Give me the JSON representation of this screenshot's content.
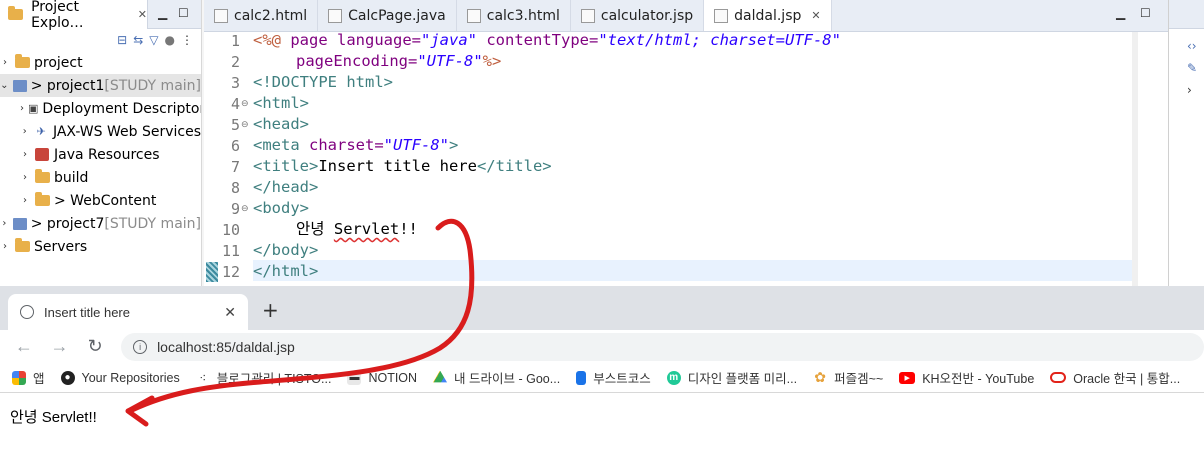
{
  "explorer": {
    "tab_title": "Project Explo…",
    "tree": [
      {
        "label": "project",
        "suffix": ""
      },
      {
        "label": "> project1",
        "suffix": " [STUDY main]"
      },
      {
        "label": "Deployment Descriptor",
        "suffix": ""
      },
      {
        "label": "JAX-WS Web Services",
        "suffix": ""
      },
      {
        "label": "Java Resources",
        "suffix": ""
      },
      {
        "label": "build",
        "suffix": ""
      },
      {
        "label": "> WebContent",
        "suffix": ""
      },
      {
        "label": "> project7",
        "suffix": " [STUDY main]"
      },
      {
        "label": "Servers",
        "suffix": ""
      }
    ]
  },
  "editor": {
    "tabs": [
      "calc2.html",
      "CalcPage.java",
      "calc3.html",
      "calculator.jsp",
      "daldal.jsp"
    ],
    "active_tab": "daldal.jsp",
    "line_numbers": [
      "1",
      "2",
      "3",
      "4",
      "5",
      "6",
      "7",
      "8",
      "9",
      "10",
      "11",
      "12"
    ],
    "code": {
      "l1_open": "<%@",
      "l1_page": " page",
      "l1_lang_attr": " language=",
      "l1_lang_val": "\"java\"",
      "l1_ct_attr": " contentType=",
      "l1_ct_val": "\"text/html; charset=UTF-8\"",
      "l2_attr": "pageEncoding=",
      "l2_val": "\"UTF-8\"",
      "l2_close": "%>",
      "l3": "<!DOCTYPE html>",
      "l4": "<html>",
      "l5": "<head>",
      "l6_tag": "<meta",
      "l6_attr": " charset=",
      "l6_val": "\"UTF-8\"",
      "l6_close": ">",
      "l7_open": "<title>",
      "l7_text": "Insert title here",
      "l7_close": "</title>",
      "l8": "</head>",
      "l9": "<body>",
      "l10_a": "안녕 ",
      "l10_b": "Servlet",
      "l10_c": "!!",
      "l11": "</body>",
      "l12": "</html>"
    }
  },
  "browser": {
    "tab_title": "Insert title here",
    "new_tab": "+",
    "url": "localhost:85/daldal.jsp",
    "bookmarks": [
      {
        "label": "앱",
        "icon": "apps-grid-icon",
        "color": "#e94235"
      },
      {
        "label": "Your Repositories",
        "icon": "github-icon",
        "color": "#222222"
      },
      {
        "label": "블로그관리 | TISTO...",
        "icon": "tistory-icon",
        "color": "#333333"
      },
      {
        "label": "NOTION",
        "icon": "notion-icon",
        "color": "#555555"
      },
      {
        "label": "내 드라이브 - Goo...",
        "icon": "google-drive-icon",
        "color": "#1fa463"
      },
      {
        "label": "부스트코스",
        "icon": "boostcourse-icon",
        "color": "#1a73e8"
      },
      {
        "label": "디자인 플랫폼 미리...",
        "icon": "miricanvas-icon",
        "color": "#20c997"
      },
      {
        "label": "퍼즐겜~~",
        "icon": "puzzle-icon",
        "color": "#e6a23c"
      },
      {
        "label": "KH오전반 - YouTube",
        "icon": "youtube-icon",
        "color": "#ff0000"
      },
      {
        "label": "Oracle 한국 | 통합...",
        "icon": "oracle-icon",
        "color": "#e2231a"
      }
    ],
    "page_text": "안녕 Servlet!!"
  },
  "colors": {
    "annotation": "#d91c1c",
    "tag": "#3f7f7f",
    "attr": "#7f007f",
    "value": "#2a00ff"
  }
}
